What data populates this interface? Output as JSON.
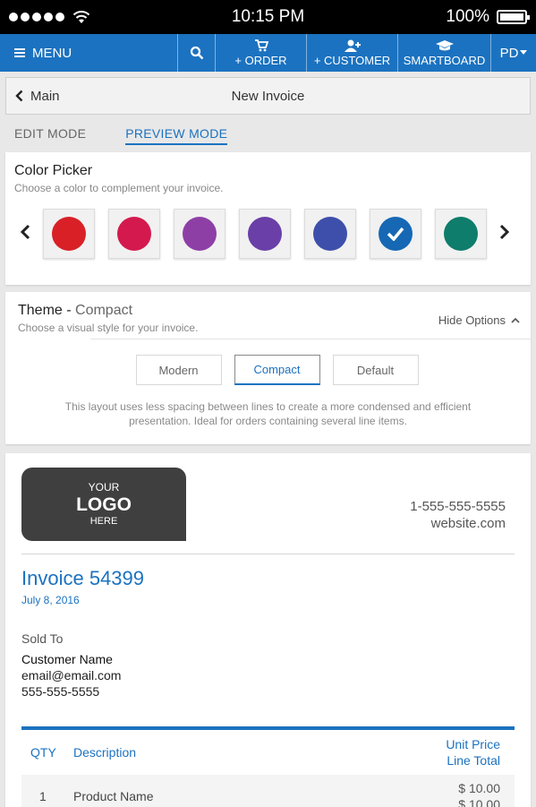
{
  "status_bar": {
    "time": "10:15 PM",
    "battery": "100%"
  },
  "nav": {
    "menu_label": "MENU",
    "order_label": "+ ORDER",
    "customer_label": "+ CUSTOMER",
    "smartboard_label": "SMARTBOARD",
    "profile_label": "PD",
    "accent": "#1b72c0"
  },
  "breadcrumb": {
    "back_label": "Main",
    "title": "New Invoice"
  },
  "modes": {
    "edit": "EDIT MODE",
    "preview": "PREVIEW MODE",
    "active": "preview"
  },
  "color_picker": {
    "title": "Color Picker",
    "subtitle": "Choose a color to complement your invoice.",
    "colors": [
      "#d92027",
      "#d4194e",
      "#8e3fa6",
      "#6a3fa8",
      "#3e4fab",
      "#1668b4",
      "#0e7d6b"
    ],
    "selected_index": 5
  },
  "theme": {
    "title": "Theme",
    "current": "Compact",
    "subtitle": "Choose a visual style for your invoice.",
    "hide_options": "Hide Options",
    "options": [
      "Modern",
      "Compact",
      "Default"
    ],
    "selected": "Compact",
    "description": "This layout uses less spacing between lines to create a more condensed and efficient presentation. Ideal for orders containing several line items."
  },
  "invoice": {
    "logo": {
      "line1": "YOUR",
      "line2": "LOGO",
      "line3": "HERE"
    },
    "phone": "1-555-555-5555",
    "website": "website.com",
    "title": "Invoice 54399",
    "date": "July 8, 2016",
    "sold_to_label": "Sold To",
    "customer_name": "Customer Name",
    "email": "email@email.com",
    "phone_customer": "555-555-5555",
    "table": {
      "qty_header": "QTY",
      "desc_header": "Description",
      "unit_price_header": "Unit Price",
      "line_total_header": "Line Total",
      "rows": [
        {
          "qty": "1",
          "description": "Product Name",
          "unit_price": "$ 10.00",
          "line_total": "$ 10.00"
        }
      ]
    }
  }
}
